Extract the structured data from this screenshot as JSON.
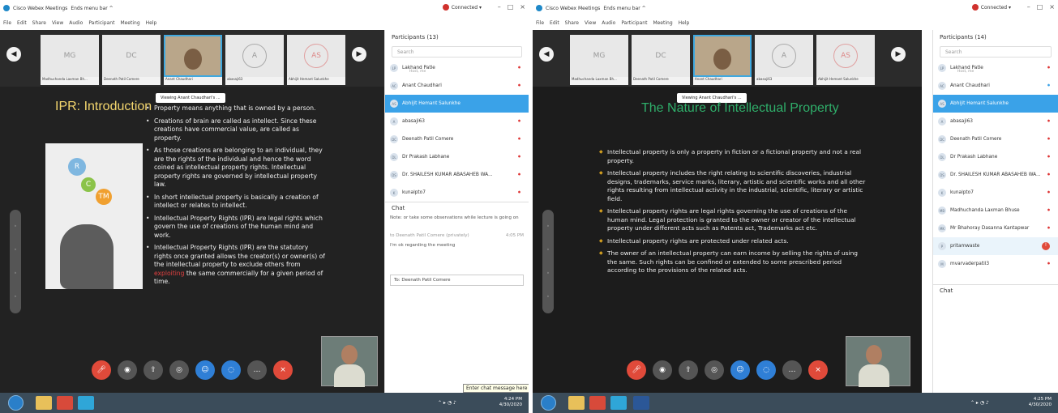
{
  "left": {
    "titlebar": {
      "app": "Cisco Webex Meetings",
      "info": "Ends menu bar ^",
      "status": "Connected ▾",
      "min": "–",
      "max": "□",
      "close": "×"
    },
    "menu": [
      "File",
      "Edit",
      "Share",
      "View",
      "Audio",
      "Participant",
      "Meeting",
      "Help"
    ],
    "thumbs": [
      {
        "initials": "MG",
        "name": "Madhuchanda Laxman Bh..."
      },
      {
        "initials": "DC",
        "name": "Deenath Patil Comere"
      },
      {
        "initials": "",
        "name": "Anant Chaudhari"
      },
      {
        "initials": "A",
        "name": "abasaji63"
      },
      {
        "initials": "AS",
        "name": "Abhijit Hemant Salunkhe"
      }
    ],
    "viewing": "Viewing Anant Chaudhari's ...",
    "slide": {
      "title": "IPR: Introduction",
      "bullets": [
        "Property means anything that is owned by a person.",
        "Creations of brain are called as intellect. Since these creations have commercial value, are called as property.",
        "As those creations are belonging to an individual, they are the rights of the individual and hence the word coined as intellectual property rights. Intellectual property rights are governed by intellectual property law.",
        "In short intellectual property is basically a creation of intellect or relates to intellect.",
        "Intellectual Property Rights (IPR) are legal rights which govern the use of creations of the human mind and work.",
        "Intellectual Property Rights (IPR) are the statutory rights once granted allows the creator(s) or owner(s) of the intellectual property to exclude others from exploiting the same commercially for a given period of time."
      ],
      "highlight_word": "exploiting",
      "bulb_letters": [
        "R",
        "C",
        "TM"
      ]
    },
    "participants": {
      "header": "Participants (13)",
      "search_placeholder": "Search",
      "items": [
        {
          "name": "Lakhand Patle",
          "sub": "Host, me"
        },
        {
          "name": "Anant Chaudhari",
          "sub": ""
        },
        {
          "name": "Abhijit Hemant Salunkhe",
          "sub": ""
        },
        {
          "name": "abasaji63",
          "sub": ""
        },
        {
          "name": "Deenath Patil Comere",
          "sub": ""
        },
        {
          "name": "Dr Prakash Labhane",
          "sub": ""
        },
        {
          "name": "Dr. SHAILESH KUMAR ABASAHEB WA...",
          "sub": ""
        },
        {
          "name": "kunalpto7",
          "sub": ""
        }
      ]
    },
    "chat": {
      "header": "Chat",
      "notice": "Note: or take some observations while lecture is going on",
      "message_from": "to Deenath Patil Comere (privately)",
      "message_time": "4:05 PM",
      "message_text": "I'm ok regarding the meeting",
      "to_label": "To:",
      "to_value": "Deenath Patil Comere",
      "tooltip": "Enter chat message here"
    },
    "taskbar": {
      "time": "4:24 PM",
      "date": "4/30/2020"
    }
  },
  "right": {
    "titlebar": {
      "app": "Cisco Webex Meetings",
      "info": "Ends menu bar ^",
      "status": "Connected ▾",
      "min": "–",
      "max": "□",
      "close": "×"
    },
    "menu": [
      "File",
      "Edit",
      "Share",
      "View",
      "Audio",
      "Participant",
      "Meeting",
      "Help"
    ],
    "thumbs": [
      {
        "initials": "MG",
        "name": "Madhuchanda Laxman Bh..."
      },
      {
        "initials": "DC",
        "name": "Deenath Patil Comere"
      },
      {
        "initials": "",
        "name": "Anant Chaudhari"
      },
      {
        "initials": "A",
        "name": "abasaji63"
      },
      {
        "initials": "AS",
        "name": "Abhijit Hemant Salunkhe"
      }
    ],
    "viewing": "Viewing Anant Chaudhari's ...",
    "slide": {
      "title": "The Nature of Intellectual Property",
      "bullets": [
        "Intellectual property is only a property in fiction or a fictional property and not a real property.",
        "Intellectual property includes the right relating to scientific discoveries, industrial designs, trademarks, service marks, literary, artistic and scientific works and all other rights resulting from intellectual activity in the industrial, scientific, literary or artistic field.",
        "Intellectual property rights are legal rights governing the use of creations of the human mind. Legal protection is granted to the owner or creator of the intellectual property under different acts such as Patents act, Trademarks act etc.",
        "Intellectual property rights are protected under related acts.",
        "The owner of an intellectual property can earn income by selling the rights of using the same. Such rights can be confined or extended to some prescribed period according to the provisions of the related acts."
      ]
    },
    "participants": {
      "header": "Participants (14)",
      "search_placeholder": "Search",
      "items": [
        {
          "name": "Lakhand Patle",
          "sub": "Host, me"
        },
        {
          "name": "Anant Chaudhari",
          "sub": ""
        },
        {
          "name": "Abhijit Hemant Salunkhe",
          "sub": ""
        },
        {
          "name": "abasaji63",
          "sub": ""
        },
        {
          "name": "Deenath Patil Comere",
          "sub": ""
        },
        {
          "name": "Dr Prakash Labhane",
          "sub": ""
        },
        {
          "name": "Dr. SHAILESH KUMAR ABASAHEB WA...",
          "sub": ""
        },
        {
          "name": "kunalpto7",
          "sub": ""
        },
        {
          "name": "Madhuchanda Laxman Bhuse",
          "sub": ""
        },
        {
          "name": "Mr Bhahoray Dasanna Kantapwar",
          "sub": ""
        },
        {
          "name": "pritamwaste",
          "sub": ""
        },
        {
          "name": "mvarvaderpatil3",
          "sub": ""
        }
      ]
    },
    "chat": {
      "header": "Chat"
    },
    "taskbar": {
      "time": "4:25 PM",
      "date": "4/30/2020"
    }
  },
  "colors": {
    "accent": "#3aa2e8",
    "leave": "#e04a3a",
    "slide_title_green": "#2fae6a",
    "slide_title_yellow": "#f5d76e"
  }
}
